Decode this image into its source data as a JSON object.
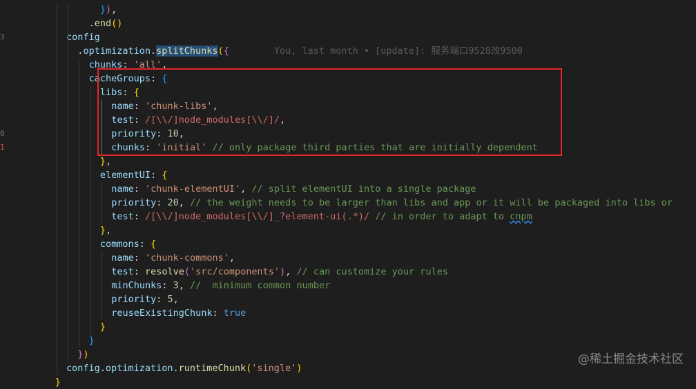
{
  "editor": {
    "line_numbers": [
      "",
      "",
      "3",
      "",
      "",
      "",
      "",
      "",
      "",
      "0",
      "1",
      "",
      "",
      "",
      "",
      "",
      "",
      "",
      "",
      "",
      "",
      "",
      "",
      "",
      "",
      "",
      "",
      ""
    ],
    "lines": [
      {
        "indent": 5,
        "tokens": [
          {
            "c": "b3",
            "t": "}"
          },
          {
            "c": "b2",
            "t": ")"
          },
          {
            "c": "k",
            "t": ","
          }
        ]
      },
      {
        "indent": 4,
        "tokens": [
          {
            "c": "k",
            "t": "."
          },
          {
            "c": "fn",
            "t": "end"
          },
          {
            "c": "b1",
            "t": "()"
          }
        ]
      },
      {
        "indent": 2,
        "tokens": [
          {
            "c": "prop",
            "t": "config"
          }
        ]
      },
      {
        "indent": 3,
        "tokens": [
          {
            "c": "k",
            "t": "."
          },
          {
            "c": "prop",
            "t": "optimization"
          },
          {
            "c": "k",
            "t": "."
          },
          {
            "c": "fn hl",
            "t": "splitChunks"
          },
          {
            "c": "b1",
            "t": "("
          },
          {
            "c": "b2",
            "t": "{"
          },
          {
            "c": "blame",
            "t": "        You, last month • [update]: 服务端口9528改9500"
          }
        ]
      },
      {
        "indent": 4,
        "tokens": [
          {
            "c": "prop",
            "t": "chunks"
          },
          {
            "c": "k",
            "t": ": "
          },
          {
            "c": "str",
            "t": "'all'"
          },
          {
            "c": "k",
            "t": ","
          }
        ]
      },
      {
        "indent": 4,
        "tokens": [
          {
            "c": "prop",
            "t": "cacheGroups"
          },
          {
            "c": "k",
            "t": ": "
          },
          {
            "c": "b3",
            "t": "{"
          }
        ]
      },
      {
        "indent": 5,
        "tokens": [
          {
            "c": "prop",
            "t": "libs"
          },
          {
            "c": "k",
            "t": ": "
          },
          {
            "c": "b1",
            "t": "{"
          }
        ]
      },
      {
        "indent": 6,
        "tokens": [
          {
            "c": "prop",
            "t": "name"
          },
          {
            "c": "k",
            "t": ": "
          },
          {
            "c": "str",
            "t": "'chunk-libs'"
          },
          {
            "c": "k",
            "t": ","
          }
        ]
      },
      {
        "indent": 6,
        "tokens": [
          {
            "c": "prop",
            "t": "test"
          },
          {
            "c": "k",
            "t": ": "
          },
          {
            "c": "regex",
            "t": "/[\\\\/]node_modules[\\\\/]/"
          },
          {
            "c": "k",
            "t": ","
          }
        ]
      },
      {
        "indent": 6,
        "tokens": [
          {
            "c": "prop",
            "t": "priority"
          },
          {
            "c": "k",
            "t": ": "
          },
          {
            "c": "num",
            "t": "10"
          },
          {
            "c": "k",
            "t": ","
          }
        ]
      },
      {
        "indent": 6,
        "tokens": [
          {
            "c": "prop",
            "t": "chunks"
          },
          {
            "c": "k",
            "t": ": "
          },
          {
            "c": "str",
            "t": "'initial'"
          },
          {
            "c": "k",
            "t": " "
          },
          {
            "c": "cmt",
            "t": "// only package third parties that are initially dependent"
          }
        ]
      },
      {
        "indent": 5,
        "tokens": [
          {
            "c": "b1",
            "t": "}"
          },
          {
            "c": "k",
            "t": ","
          }
        ]
      },
      {
        "indent": 5,
        "tokens": [
          {
            "c": "prop",
            "t": "elementUI"
          },
          {
            "c": "k",
            "t": ": "
          },
          {
            "c": "b1",
            "t": "{"
          }
        ]
      },
      {
        "indent": 6,
        "tokens": [
          {
            "c": "prop",
            "t": "name"
          },
          {
            "c": "k",
            "t": ": "
          },
          {
            "c": "str",
            "t": "'chunk-elementUI'"
          },
          {
            "c": "k",
            "t": ", "
          },
          {
            "c": "cmt",
            "t": "// split elementUI into a single package"
          }
        ]
      },
      {
        "indent": 6,
        "tokens": [
          {
            "c": "prop",
            "t": "priority"
          },
          {
            "c": "k",
            "t": ": "
          },
          {
            "c": "num",
            "t": "20"
          },
          {
            "c": "k",
            "t": ", "
          },
          {
            "c": "cmt",
            "t": "// the weight needs to be larger than libs and app or it will be packaged into libs or"
          }
        ]
      },
      {
        "indent": 6,
        "tokens": [
          {
            "c": "prop",
            "t": "test"
          },
          {
            "c": "k",
            "t": ": "
          },
          {
            "c": "regex",
            "t": "/[\\\\/]node_modules[\\\\/]_?element-ui(.*)/"
          },
          {
            "c": "k",
            "t": " "
          },
          {
            "c": "cmt",
            "t": "// in order to adapt to "
          },
          {
            "c": "cmt squig",
            "t": "cnpm"
          }
        ]
      },
      {
        "indent": 5,
        "tokens": [
          {
            "c": "b1",
            "t": "}"
          },
          {
            "c": "k",
            "t": ","
          }
        ]
      },
      {
        "indent": 5,
        "tokens": [
          {
            "c": "prop",
            "t": "commons"
          },
          {
            "c": "k",
            "t": ": "
          },
          {
            "c": "b1",
            "t": "{"
          }
        ]
      },
      {
        "indent": 6,
        "tokens": [
          {
            "c": "prop",
            "t": "name"
          },
          {
            "c": "k",
            "t": ": "
          },
          {
            "c": "str",
            "t": "'chunk-commons'"
          },
          {
            "c": "k",
            "t": ","
          }
        ]
      },
      {
        "indent": 6,
        "tokens": [
          {
            "c": "prop",
            "t": "test"
          },
          {
            "c": "k",
            "t": ": "
          },
          {
            "c": "fn",
            "t": "resolve"
          },
          {
            "c": "b2",
            "t": "("
          },
          {
            "c": "str",
            "t": "'src/components'"
          },
          {
            "c": "b2",
            "t": ")"
          },
          {
            "c": "k",
            "t": ", "
          },
          {
            "c": "cmt",
            "t": "// can customize your rules"
          }
        ]
      },
      {
        "indent": 6,
        "tokens": [
          {
            "c": "prop",
            "t": "minChunks"
          },
          {
            "c": "k",
            "t": ": "
          },
          {
            "c": "num",
            "t": "3"
          },
          {
            "c": "k",
            "t": ", "
          },
          {
            "c": "cmt",
            "t": "//  minimum common number"
          }
        ]
      },
      {
        "indent": 6,
        "tokens": [
          {
            "c": "prop",
            "t": "priority"
          },
          {
            "c": "k",
            "t": ": "
          },
          {
            "c": "num",
            "t": "5"
          },
          {
            "c": "k",
            "t": ","
          }
        ]
      },
      {
        "indent": 6,
        "tokens": [
          {
            "c": "prop",
            "t": "reuseExistingChunk"
          },
          {
            "c": "k",
            "t": ": "
          },
          {
            "c": "bool",
            "t": "true"
          }
        ]
      },
      {
        "indent": 5,
        "tokens": [
          {
            "c": "b1",
            "t": "}"
          }
        ]
      },
      {
        "indent": 4,
        "tokens": [
          {
            "c": "b3",
            "t": "}"
          }
        ]
      },
      {
        "indent": 3,
        "tokens": [
          {
            "c": "b2",
            "t": "}"
          },
          {
            "c": "b1",
            "t": ")"
          }
        ]
      },
      {
        "indent": 2,
        "tokens": [
          {
            "c": "prop",
            "t": "config"
          },
          {
            "c": "k",
            "t": "."
          },
          {
            "c": "prop",
            "t": "optimization"
          },
          {
            "c": "k",
            "t": "."
          },
          {
            "c": "fn",
            "t": "runtimeChunk"
          },
          {
            "c": "b1",
            "t": "("
          },
          {
            "c": "str",
            "t": "'single'"
          },
          {
            "c": "b1",
            "t": ")"
          }
        ]
      },
      {
        "indent": 1,
        "tokens": [
          {
            "c": "b1",
            "t": "}"
          }
        ]
      }
    ]
  },
  "highlight_box_color": "#e2262a",
  "watermark": "@稀土掘金技术社区"
}
